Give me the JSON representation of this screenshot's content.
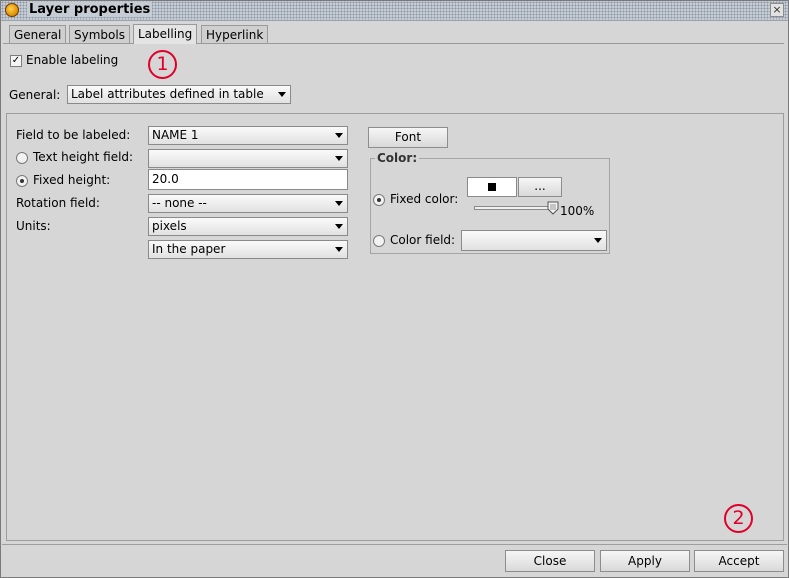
{
  "window": {
    "title": "Layer properties",
    "close_glyph": "×"
  },
  "tabs": [
    {
      "label": "General",
      "active": false
    },
    {
      "label": "Symbols",
      "active": false
    },
    {
      "label": "Labelling",
      "active": true
    },
    {
      "label": "Hyperlink",
      "active": false
    }
  ],
  "enable_labeling": {
    "label": "Enable labeling",
    "checked": true
  },
  "general": {
    "label": "General:",
    "value": "Label attributes defined in table"
  },
  "fields": {
    "field_to_label": {
      "label": "Field to be labeled:",
      "value": "NAME 1"
    },
    "text_height_field": {
      "label": "Text height field:",
      "value": "",
      "selected": false
    },
    "fixed_height": {
      "label": "Fixed height:",
      "value": "20.0",
      "selected": true
    },
    "rotation_field": {
      "label": "Rotation field:",
      "value": "-- none --"
    },
    "units": {
      "label": "Units:",
      "value": "pixels"
    },
    "reference": {
      "value": "In the paper"
    }
  },
  "font_button": "Font",
  "color": {
    "legend": "Color:",
    "fixed_color_label": "Fixed color:",
    "fixed_selected": true,
    "swatch_color": "#000000",
    "more_button": "...",
    "transparency_percent": "100%",
    "color_field_label": "Color field:",
    "color_field_value": ""
  },
  "annotations": {
    "one": "1",
    "two": "2",
    "color": "#e0002a"
  },
  "footer": {
    "close": "Close",
    "apply": "Apply",
    "accept": "Accept"
  }
}
